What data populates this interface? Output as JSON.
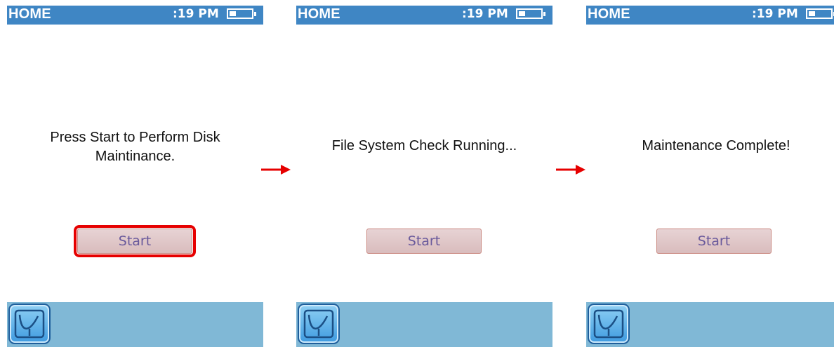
{
  "screens": [
    {
      "header_title": "HOME",
      "time": ":19 PM",
      "message_line1": "Press Start to Perform Disk",
      "message_line2": "Maintinance.",
      "start_label": "Start"
    },
    {
      "header_title": "HOME",
      "time": ":19 PM",
      "message": "File System Check Running...",
      "start_label": "Start"
    },
    {
      "header_title": "HOME",
      "time": ":19 PM",
      "message": "Maintenance Complete!",
      "start_label": "Start"
    }
  ],
  "icons": {
    "battery": "battery-icon",
    "app": "app-launcher-icon",
    "arrow": "right-arrow-icon"
  },
  "colors": {
    "header_bg": "#3f86c4",
    "footer_bg": "#80b8d6",
    "highlight": "#e60000",
    "button_text": "#6a5a9c"
  }
}
